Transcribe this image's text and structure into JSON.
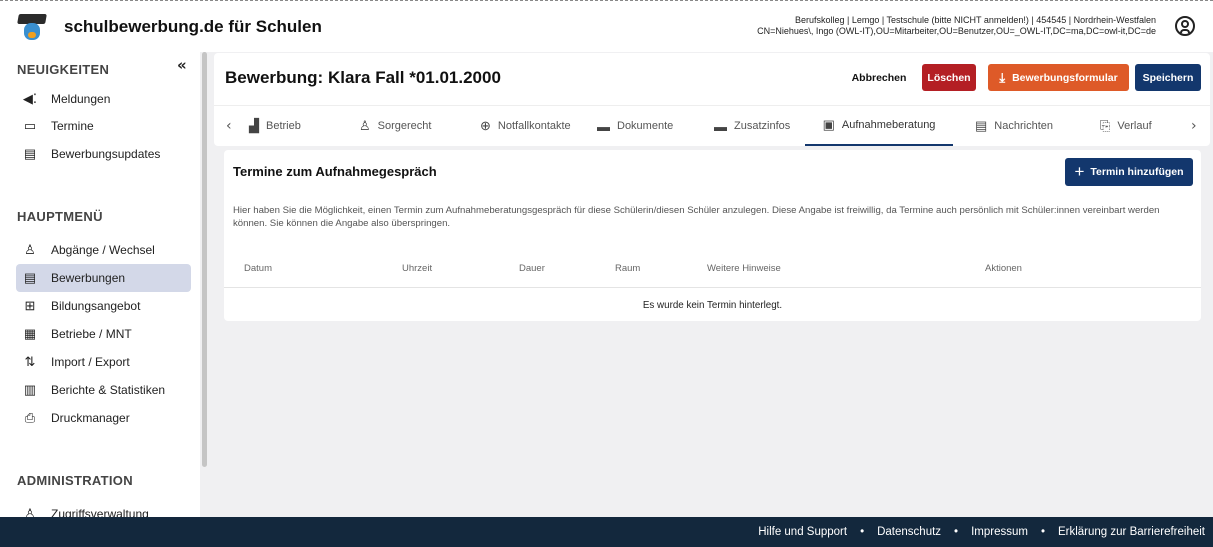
{
  "app": {
    "brand": "schulbewerbung.de für Schulen",
    "user_line1": "Berufskolleg | Lemgo | Testschule (bitte NICHT anmelden!) | 454545 | Nordrhein-Westfalen",
    "user_line2": "CN=Niehues\\, Ingo (OWL-IT),OU=Mitarbeiter,OU=Benutzer,OU=_OWL-IT,DC=ma,DC=owl-it,DC=de"
  },
  "sidebar": {
    "news_heading": "NEUIGKEITEN",
    "collapse_icon": "«",
    "news_items": [
      {
        "label": "Meldungen",
        "icon": "megaphone-icon"
      },
      {
        "label": "Termine",
        "icon": "calendar-icon"
      },
      {
        "label": "Bewerbungsupdates",
        "icon": "application-update-icon"
      }
    ],
    "main_heading": "HAUPTMENÜ",
    "main_items": [
      {
        "label": "Abgänge / Wechsel",
        "icon": "person-icon"
      },
      {
        "label": "Bewerbungen",
        "icon": "application-icon",
        "active": true
      },
      {
        "label": "Bildungsangebot",
        "icon": "sitemap-icon"
      },
      {
        "label": "Betriebe / MNT",
        "icon": "building-icon"
      },
      {
        "label": "Import / Export",
        "icon": "import-export-icon"
      },
      {
        "label": "Berichte & Statistiken",
        "icon": "chart-icon"
      },
      {
        "label": "Druckmanager",
        "icon": "printer-icon"
      }
    ],
    "admin_heading": "ADMINISTRATION",
    "admin_items": [
      {
        "label": "Zugriffsverwaltung",
        "icon": "access-icon"
      }
    ]
  },
  "header": {
    "title": "Bewerbung: Klara Fall *01.01.2000",
    "cancel_label": "Abbrechen",
    "delete_label": "Löschen",
    "form_label": "Bewerbungsformular",
    "save_label": "Speichern"
  },
  "tabs": [
    {
      "label": "Betrieb",
      "icon": "factory-icon"
    },
    {
      "label": "Sorgerecht",
      "icon": "family-icon"
    },
    {
      "label": "Notfallkontakte",
      "icon": "medical-icon"
    },
    {
      "label": "Dokumente",
      "icon": "folder-icon"
    },
    {
      "label": "Zusatzinfos",
      "icon": "info-folder-icon"
    },
    {
      "label": "Aufnahmeberatung",
      "icon": "calendar-icon",
      "active": true
    },
    {
      "label": "Nachrichten",
      "icon": "message-icon"
    },
    {
      "label": "Verlauf",
      "icon": "history-icon"
    }
  ],
  "content": {
    "title": "Termine zum Aufnahmegespräch",
    "add_label": "Termin hinzufügen",
    "description": "Hier haben Sie die Möglichkeit, einen Termin zum Aufnahmeberatungsgespräch für diese Schülerin/diesen Schüler anzulegen. Diese Angabe ist freiwillig, da Termine auch persönlich mit Schüler:innen vereinbart werden können. Sie können die Angabe also überspringen.",
    "columns": [
      "Datum",
      "Uhrzeit",
      "Dauer",
      "Raum",
      "Weitere Hinweise",
      "Aktionen"
    ],
    "empty_text": "Es wurde kein Termin hinterlegt."
  },
  "footer": {
    "links": [
      "Hilfe und Support",
      "Datenschutz",
      "Impressum",
      "Erklärung zur Barrierefreiheit"
    ],
    "separator": "•"
  },
  "colors": {
    "primary": "#13376d",
    "danger": "#b41f24",
    "orange": "#de5a28",
    "footer": "#13283d",
    "active_nav": "#d3d8e8"
  }
}
